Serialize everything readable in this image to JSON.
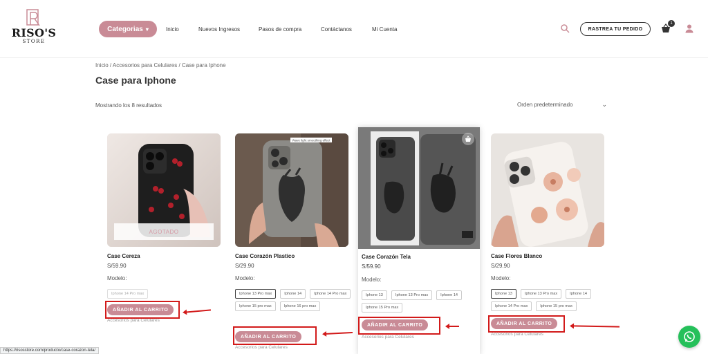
{
  "header": {
    "logo_brand": "RISO'S",
    "logo_sub": "STORE",
    "categories_label": "Categorias",
    "nav": [
      "Inicio",
      "Nuevos Ingresos",
      "Pasos de compra",
      "Contáctanos",
      "Mi Cuenta"
    ],
    "track_label": "RASTREA TU PEDIDO",
    "cart_count": "1"
  },
  "page": {
    "breadcrumb": "Inicio / Accesorios para Celulares / Case para Iphone",
    "title": "Case para Iphone",
    "results": "Mostrando los 8 resultados",
    "sort_label": "Orden predeterminado"
  },
  "products": [
    {
      "name": "Case Cereza",
      "price": "S/59.90",
      "label": "Modelo:",
      "variants": [
        "Iphone 14 Pro max"
      ],
      "add_label": "AÑADIR AL CARRITO",
      "category": "Accesorios para Celulares",
      "overlay": "AGOTADO"
    },
    {
      "name": "Case Corazón Plastico",
      "price": "S/29.90",
      "label": "Modelo:",
      "variants": [
        "Iphone 13 Pro max",
        "Iphone 14",
        "Iphone 14 Pro max",
        "Iphone 15 pro max",
        "Iphone 16 pro max"
      ],
      "add_label": "AÑADIR AL CARRITO",
      "category": "Accesorios para Celulares",
      "image_caption": "Wave light smoothing effect"
    },
    {
      "name": "Case Corazón Tela",
      "price": "S/59.90",
      "label": "Modelo:",
      "variants": [
        "Iphone 13",
        "Iphone 13 Pro max",
        "Iphone 14",
        "Iphone 15 Pro max"
      ],
      "add_label": "AÑADIR AL CARRITO",
      "category": "Accesorios para Celulares"
    },
    {
      "name": "Case Flores Blanco",
      "price": "S/29.90",
      "label": "Modelo:",
      "variants": [
        "Iphone 13",
        "Iphone 13 Pro max",
        "Iphone 14",
        "Iphone 14 Pro max",
        "Iphone 15 pro max"
      ],
      "add_label": "AÑADIR AL CARRITO",
      "category": "Accesorios para Celulares"
    }
  ],
  "status_url": "https://risosstore.com/producto/case-corazon-tela/",
  "colors": {
    "accent": "#c98b96",
    "annotation": "#d21a1a",
    "whatsapp": "#25c05a"
  },
  "icons": [
    "search-icon",
    "cart-icon",
    "user-icon",
    "whatsapp-icon",
    "chevron-down-icon",
    "bag-icon"
  ]
}
